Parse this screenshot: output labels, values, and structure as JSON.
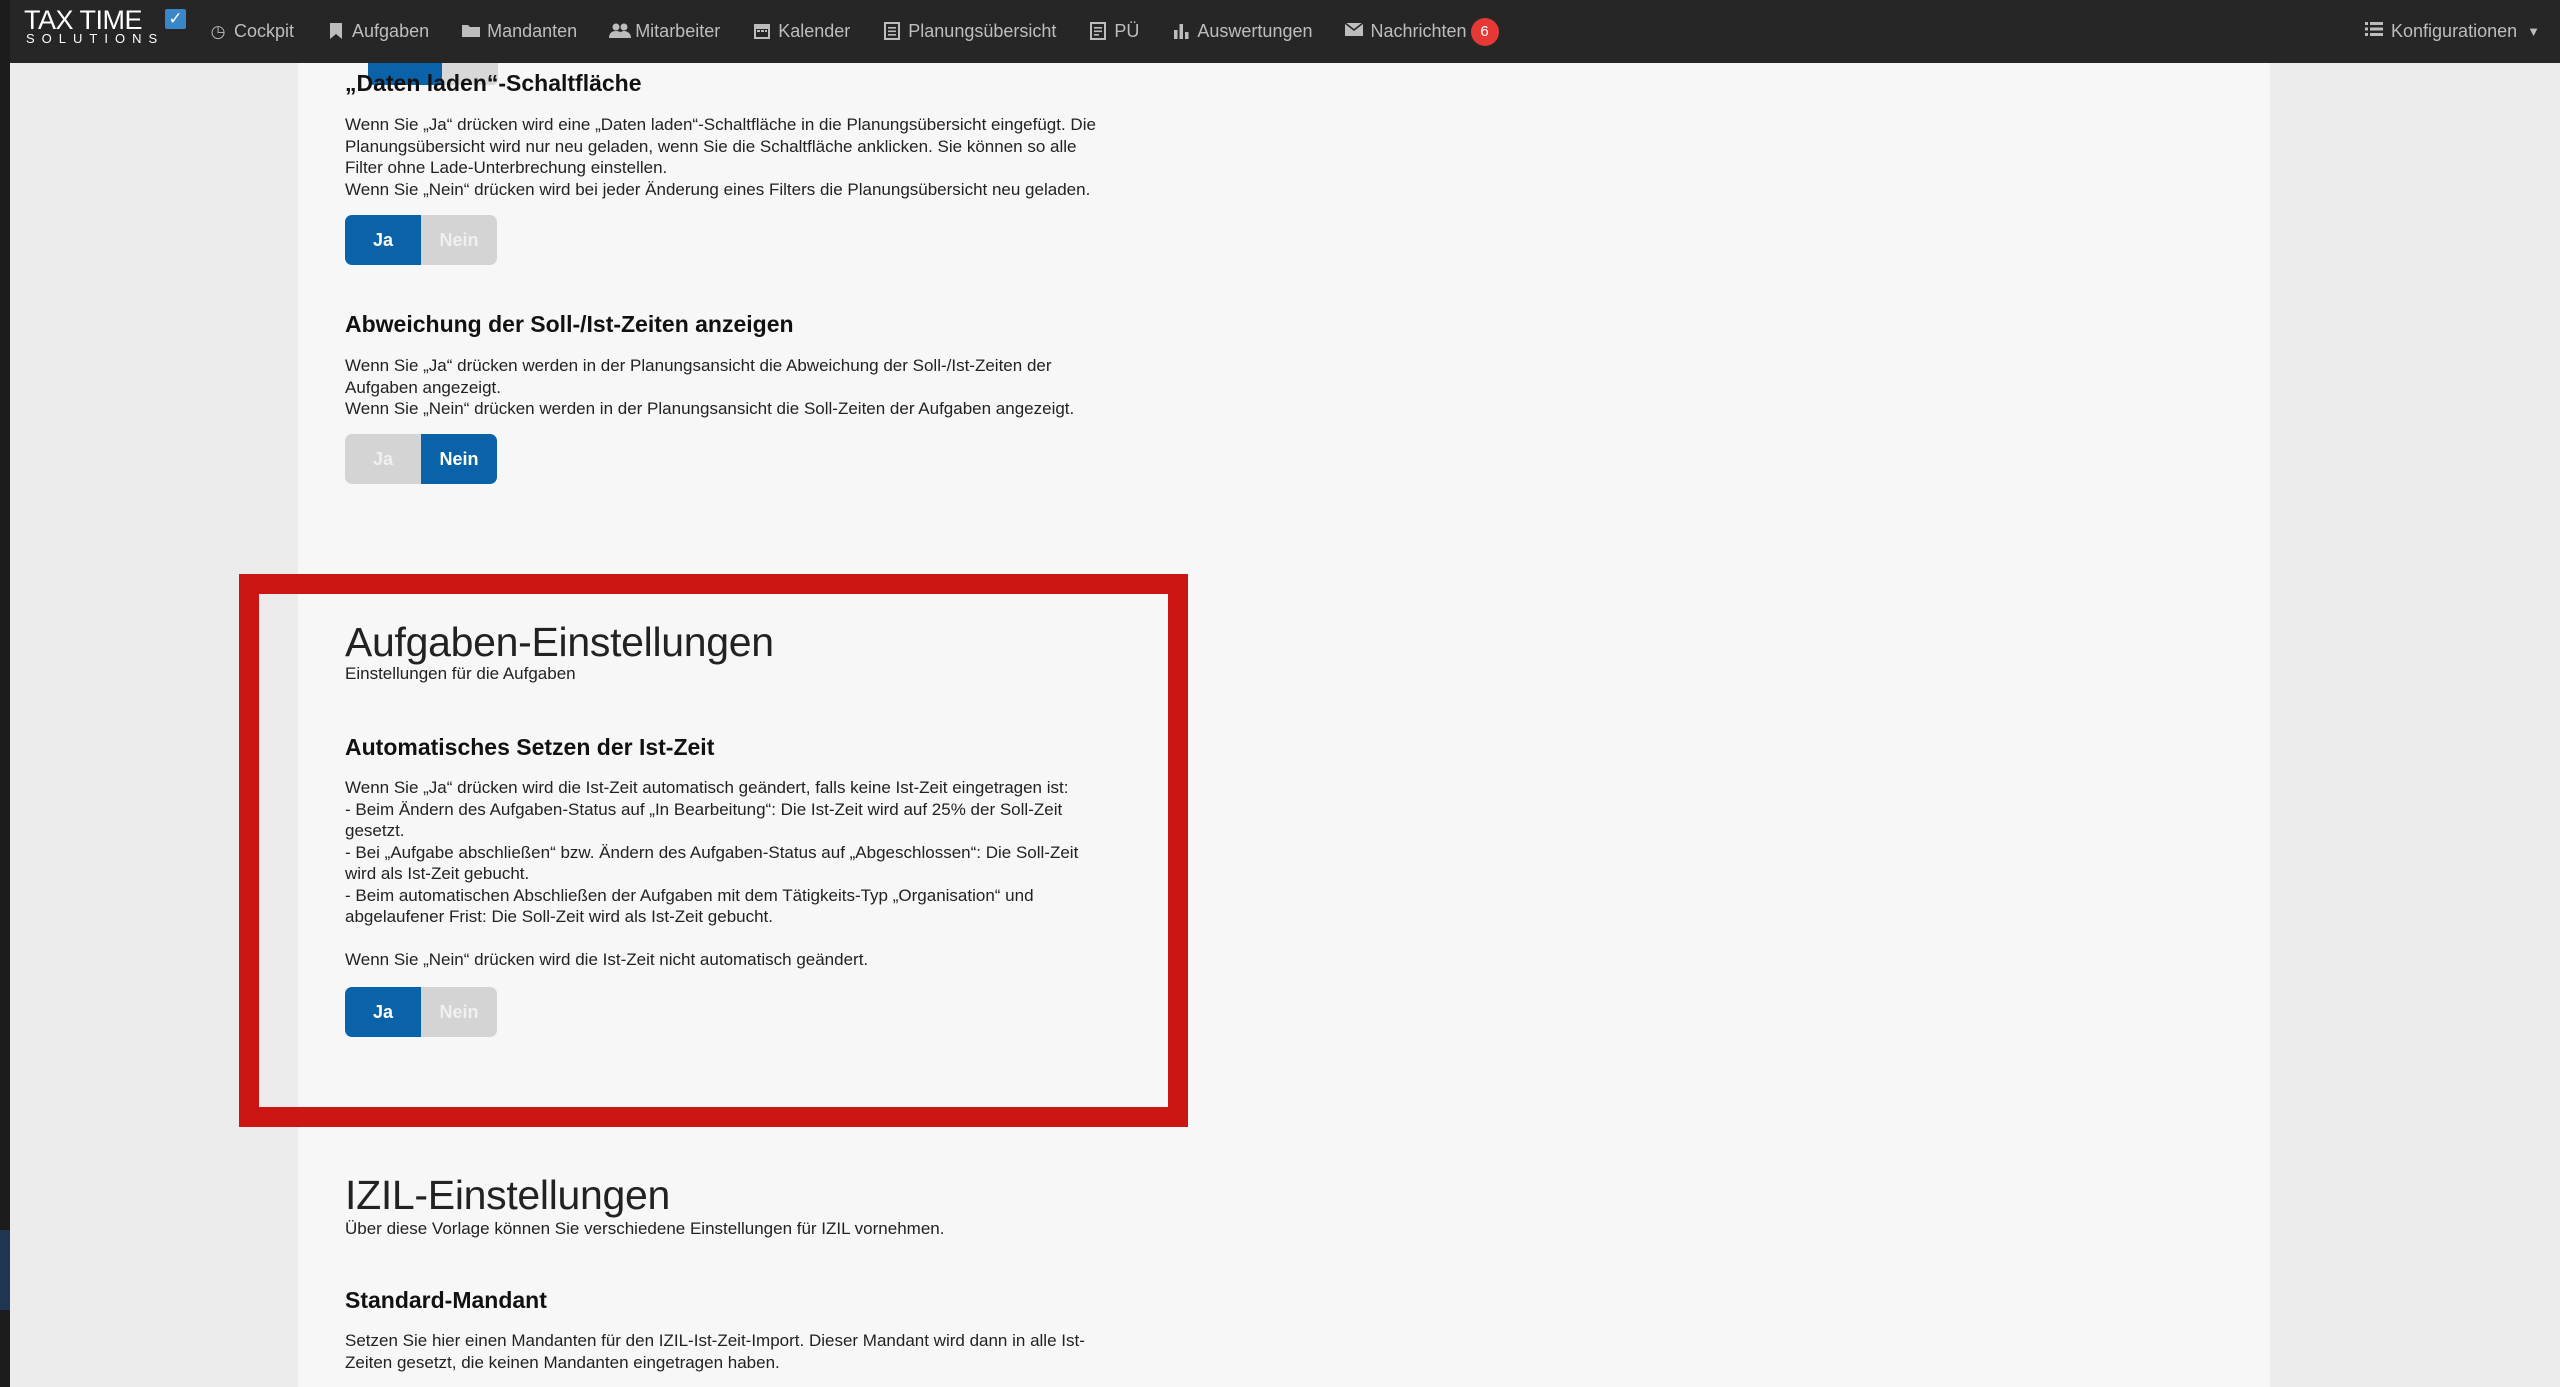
{
  "nav": {
    "logo_line1": "TAX TIME",
    "logo_line2": "SOLUTIONS",
    "items": [
      {
        "label": "Cockpit"
      },
      {
        "label": "Aufgaben"
      },
      {
        "label": "Mandanten"
      },
      {
        "label": "Mitarbeiter"
      },
      {
        "label": "Kalender"
      },
      {
        "label": "Planungsübersicht"
      },
      {
        "label": "PÜ"
      },
      {
        "label": "Auswertungen"
      },
      {
        "label": "Nachrichten"
      }
    ],
    "messages_count": "6",
    "config_label": "Konfigurationen"
  },
  "sections": {
    "daten_laden": {
      "title": "„Daten laden“-Schaltfläche",
      "line1": "Wenn Sie „Ja“ drücken wird eine „Daten laden“-Schaltfläche in die Planungsübersicht eingefügt. Die",
      "line2": "Planungsübersicht wird nur neu geladen, wenn Sie die Schaltfläche anklicken. Sie können so alle",
      "line3": "Filter ohne Lade-Unterbrechung einstellen.",
      "line4": "Wenn Sie „Nein“ drücken wird bei jeder Änderung eines Filters die Planungsübersicht neu geladen.",
      "yes": "Ja",
      "no": "Nein",
      "selected": "Ja"
    },
    "abweichung": {
      "title": "Abweichung der Soll-/Ist-Zeiten anzeigen",
      "line1": "Wenn Sie „Ja“ drücken werden in der Planungsansicht die Abweichung der Soll-/Ist-Zeiten der",
      "line2": "Aufgaben angezeigt.",
      "line3": "Wenn Sie „Nein“ drücken werden in der Planungsansicht die Soll-Zeiten der Aufgaben angezeigt.",
      "yes": "Ja",
      "no": "Nein",
      "selected": "Nein"
    },
    "aufgaben": {
      "heading": "Aufgaben-Einstellungen",
      "subheading": "Einstellungen für die Aufgaben",
      "title": "Automatisches Setzen der Ist-Zeit",
      "line1": "Wenn Sie „Ja“ drücken wird die Ist-Zeit automatisch geändert, falls keine Ist-Zeit eingetragen ist:",
      "line2": "- Beim Ändern des Aufgaben-Status auf „In Bearbeitung“: Die Ist-Zeit wird auf 25% der Soll-Zeit",
      "line3": "gesetzt.",
      "line4": "- Bei „Aufgabe abschließen“ bzw. Ändern des Aufgaben-Status auf „Abgeschlossen“: Die Soll-Zeit",
      "line5": "wird als Ist-Zeit gebucht.",
      "line6": "- Beim automatischen Abschließen der Aufgaben mit dem Tätigkeits-Typ „Organisation“ und",
      "line7": "abgelaufener Frist: Die Soll-Zeit wird als Ist-Zeit gebucht.",
      "line8": "Wenn Sie „Nein“ drücken wird die Ist-Zeit nicht automatisch geändert.",
      "yes": "Ja",
      "no": "Nein",
      "selected": "Ja"
    },
    "izil": {
      "heading": "IZIL-Einstellungen",
      "subheading": "Über diese Vorlage können Sie verschiedene Einstellungen für IZIL vornehmen.",
      "title": "Standard-Mandant",
      "line1": "Setzen Sie hier einen Mandanten für den IZIL-Ist-Zeit-Import. Dieser Mandant wird dann in alle Ist-",
      "line2": "Zeiten gesetzt, die keinen Mandanten eingetragen haben."
    }
  },
  "colors": {
    "nav_bg": "#262626",
    "primary_blue": "#0a63a8",
    "highlight_red": "#cc1515",
    "badge_red": "#e53935"
  },
  "icons": [
    "clock-icon",
    "bookmark-icon",
    "folder-icon",
    "users-icon",
    "calendar-icon",
    "list-icon",
    "document-icon",
    "bar-chart-icon",
    "envelope-icon",
    "list-menu-icon",
    "chevron-down-icon"
  ]
}
